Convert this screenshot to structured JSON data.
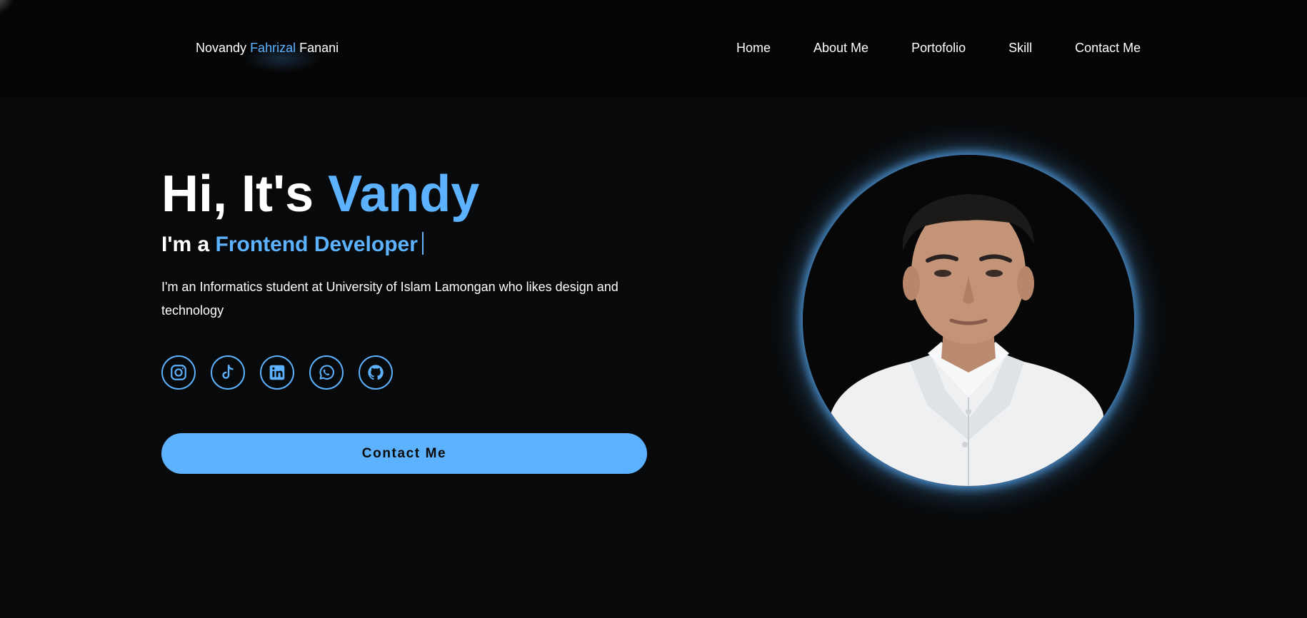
{
  "brand": {
    "first": "Novandy",
    "middle": "Fahrizal",
    "last": "Fanani"
  },
  "nav": {
    "items": [
      "Home",
      "About Me",
      "Portofolio",
      "Skill",
      "Contact Me"
    ]
  },
  "hero": {
    "greeting": "Hi, It's",
    "name": "Vandy",
    "role_prefix": "I'm a",
    "role": "Frontend Developer",
    "description": "I'm an Informatics student at University of Islam Lamongan who likes design and technology"
  },
  "socials": [
    {
      "icon": "instagram-icon"
    },
    {
      "icon": "tiktok-icon"
    },
    {
      "icon": "linkedin-icon"
    },
    {
      "icon": "whatsapp-icon"
    },
    {
      "icon": "github-icon"
    }
  ],
  "cta": {
    "label": "Contact Me"
  },
  "colors": {
    "background": "#08090a",
    "header": "#050505",
    "accent": "#5cb2ff",
    "text": "#ffffff"
  }
}
